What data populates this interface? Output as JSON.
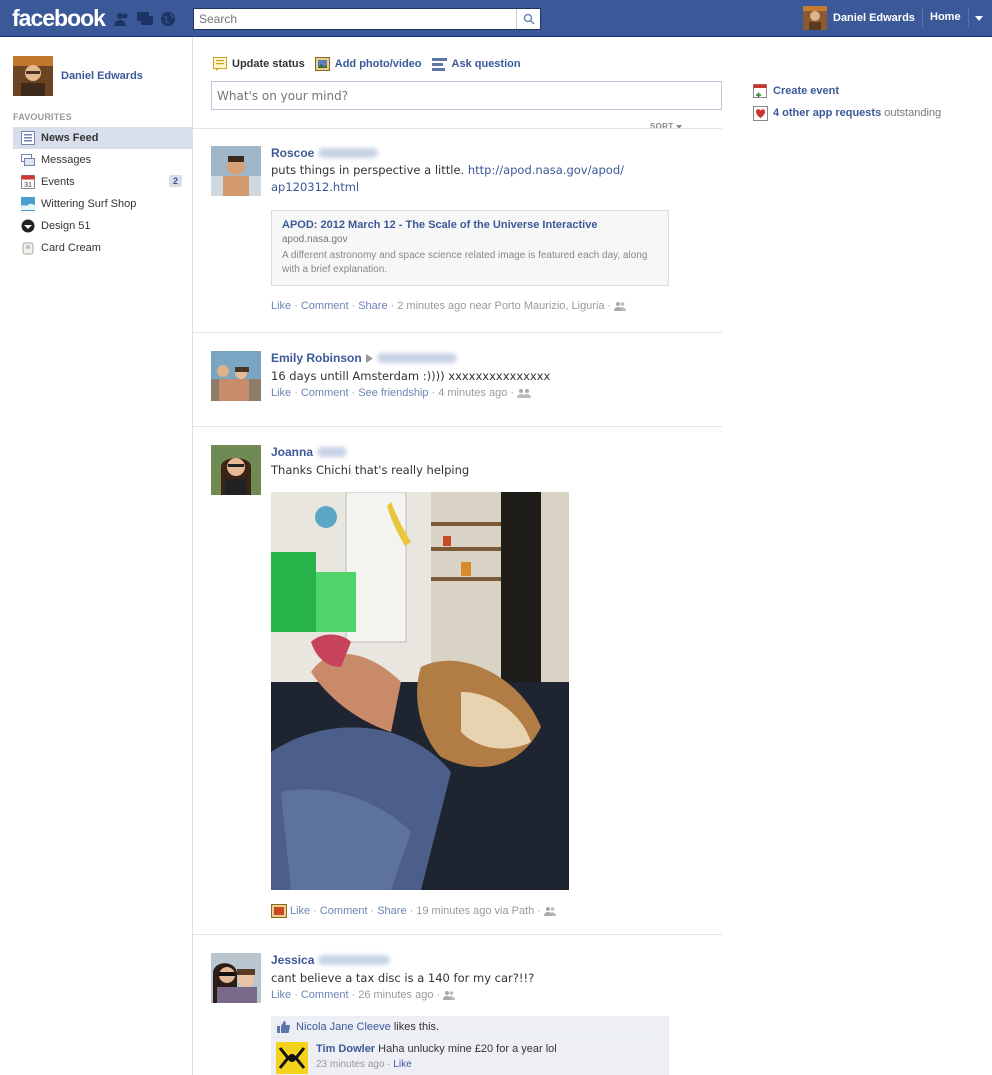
{
  "header": {
    "logo": "facebook",
    "search_placeholder": "Search",
    "user_name": "Daniel Edwards",
    "home_label": "Home"
  },
  "sidebar": {
    "user_name": "Daniel Edwards",
    "section_title": "FAVOURITES",
    "items": [
      {
        "label": "News Feed",
        "icon": "news-feed-icon",
        "active": true
      },
      {
        "label": "Messages",
        "icon": "messages-icon"
      },
      {
        "label": "Events",
        "icon": "calendar-icon",
        "badge": "2"
      },
      {
        "label": "Wittering Surf Shop",
        "icon": "page-icon"
      },
      {
        "label": "Design 51",
        "icon": "page-icon"
      },
      {
        "label": "Card Cream",
        "icon": "app-icon"
      }
    ]
  },
  "composer": {
    "tabs": [
      {
        "label": "Update status",
        "icon": "status-icon"
      },
      {
        "label": "Add photo/video",
        "icon": "photo-icon"
      },
      {
        "label": "Ask question",
        "icon": "question-icon"
      }
    ],
    "placeholder": "What's on your mind?",
    "sort_label": "SORT"
  },
  "stories": [
    {
      "name": "Roscoe",
      "text": "puts things in perspective a little.",
      "link": "http://apod.nasa.gov/apod/ ap120312.html",
      "link_line1": "http://apod.nasa.gov/apod/",
      "link_line2": "ap120312.html",
      "attachment": {
        "title": "APOD: 2012 March 12 - The Scale of the Universe Interactive",
        "domain": "apod.nasa.gov",
        "description": "A different astronomy and space science related image is featured each day, along with a brief explanation."
      },
      "actions": [
        "Like",
        "Comment",
        "Share"
      ],
      "time": "2 minutes ago near Porto Maurizio, Liguria"
    },
    {
      "name": "Emily Robinson",
      "text": "16 days untill Amsterdam :)))) xxxxxxxxxxxxxxx",
      "actions": [
        "Like",
        "Comment",
        "See friendship"
      ],
      "time": "4 minutes ago"
    },
    {
      "name": "Joanna",
      "text": "Thanks Chichi that's really helping",
      "actions": [
        "Like",
        "Comment",
        "Share"
      ],
      "time": "19 minutes ago via Path"
    },
    {
      "name": "Jessica",
      "text": "cant believe a tax disc is a 140 for my car?!!?",
      "actions": [
        "Like",
        "Comment"
      ],
      "time": "26 minutes ago",
      "likes_name": "Nicola Jane Cleeve",
      "likes_suffix": "likes this.",
      "comment": {
        "author": "Tim Dowler",
        "text": "Haha unlucky mine £20 for a year lol",
        "time": "23 minutes ago",
        "like": "Like"
      }
    }
  ],
  "right": {
    "create_event": "Create event",
    "requests_link": "4 other app requests",
    "requests_suffix": "outstanding"
  },
  "separators": {
    "dot": "·"
  }
}
